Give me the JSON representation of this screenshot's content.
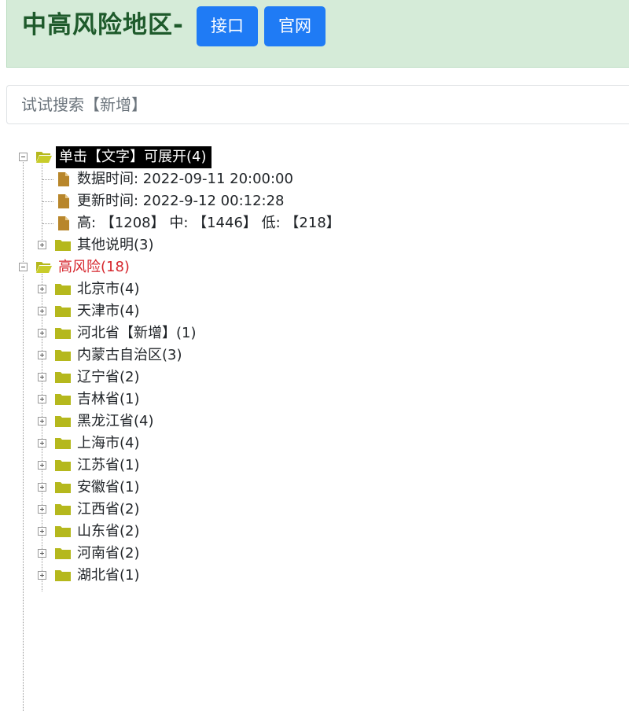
{
  "header": {
    "title": "中高风险地区-",
    "api_button": "接口",
    "site_button": "官网"
  },
  "search": {
    "placeholder": "试试搜索【新增】"
  },
  "tree": {
    "root": {
      "label": "单击【文字】可展开(4)",
      "children": [
        "数据时间: 2022-09-11 20:00:00",
        "更新时间: 2022-9-12 00:12:28",
        "高: 【1208】 中: 【1446】 低: 【218】",
        "其他说明(3)"
      ]
    },
    "high_risk": {
      "label": "高风险(18)",
      "children": [
        "北京市(4)",
        "天津市(4)",
        "河北省【新增】(1)",
        "内蒙古自治区(3)",
        "辽宁省(2)",
        "吉林省(1)",
        "黑龙江省(4)",
        "上海市(4)",
        "江苏省(1)",
        "安徽省(1)",
        "江西省(2)",
        "山东省(2)",
        "河南省(2)",
        "湖北省(1)"
      ]
    }
  },
  "colors": {
    "header_bg": "#d5ebd8",
    "title": "#1e5a2b",
    "button": "#1f7bf5",
    "folder": "#b5b81d",
    "file": "#b8862b",
    "high_risk_label": "#d6262d"
  }
}
